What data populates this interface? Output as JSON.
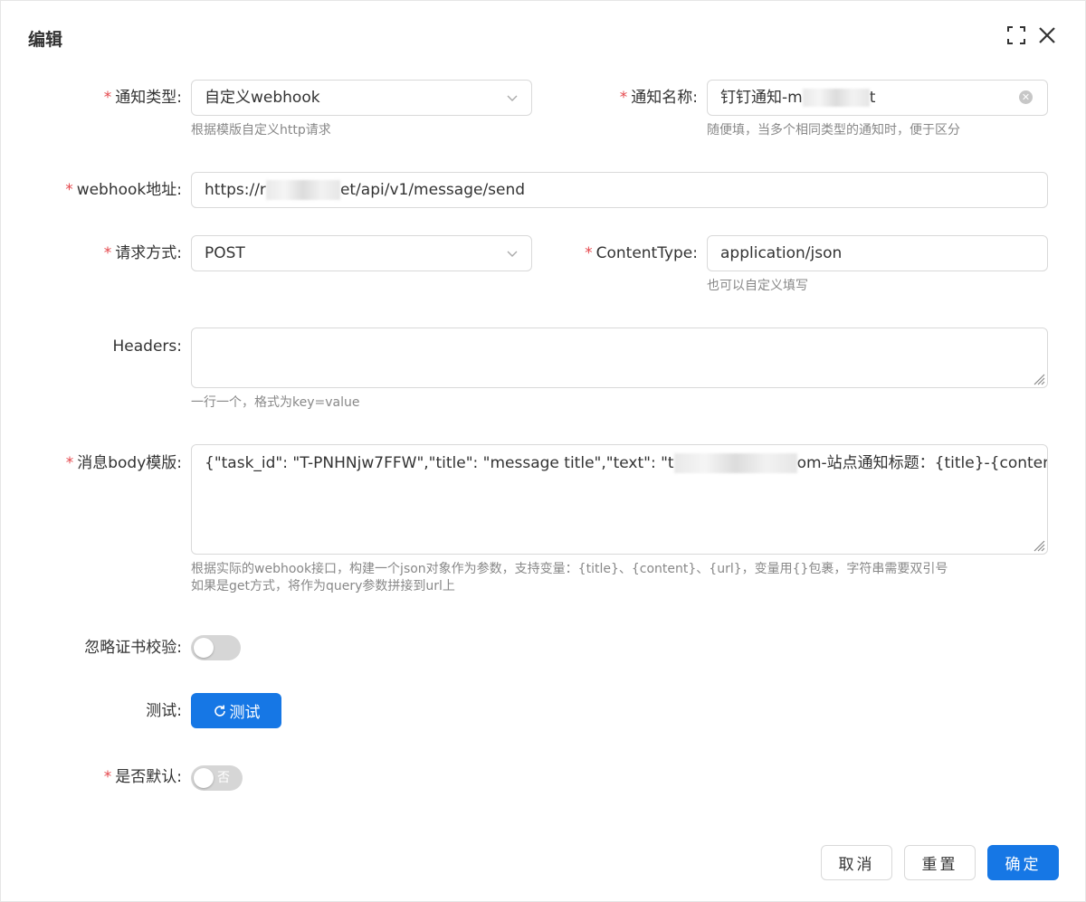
{
  "dialog": {
    "title": "编辑"
  },
  "form": {
    "notify_type": {
      "label": "通知类型:",
      "value": "自定义webhook",
      "hint": "根据模版自定义http请求"
    },
    "notify_name": {
      "label": "通知名称:",
      "value_prefix": "钉钉通知-m",
      "value_suffix": "t",
      "hint": "随便填，当多个相同类型的通知时，便于区分"
    },
    "webhook": {
      "label": "webhook地址:",
      "value_prefix": "https://r",
      "value_suffix": "et/api/v1/message/send"
    },
    "method": {
      "label": "请求方式:",
      "value": "POST"
    },
    "content_type": {
      "label": "ContentType:",
      "value": "application/json",
      "hint": "也可以自定义填写"
    },
    "headers": {
      "label": "Headers:",
      "value": "",
      "hint": "一行一个，格式为key=value"
    },
    "body": {
      "label": "消息body模版:",
      "value_prefix": "{\"task_id\": \"T-PNHNjw7FFW\",\"title\": \"message title\",\"text\": \"t",
      "value_suffix": "om-站点通知标题：{title}-{content}\"}",
      "hint_line1": "根据实际的webhook接口，构建一个json对象作为参数，支持变量：{title}、{content}、{url}，变量用{}包裹，字符串需要双引号",
      "hint_line2": "如果是get方式，将作为query参数拼接到url上"
    },
    "ignore_cert": {
      "label": "忽略证书校验:",
      "enabled": false
    },
    "test": {
      "label": "测试:",
      "button": "测试"
    },
    "is_default": {
      "label": "是否默认:",
      "enabled": false,
      "text": "否"
    }
  },
  "footer": {
    "cancel": "取消",
    "reset": "重置",
    "confirm": "确定"
  },
  "colors": {
    "primary": "#1677e5",
    "required": "#e5484d"
  }
}
